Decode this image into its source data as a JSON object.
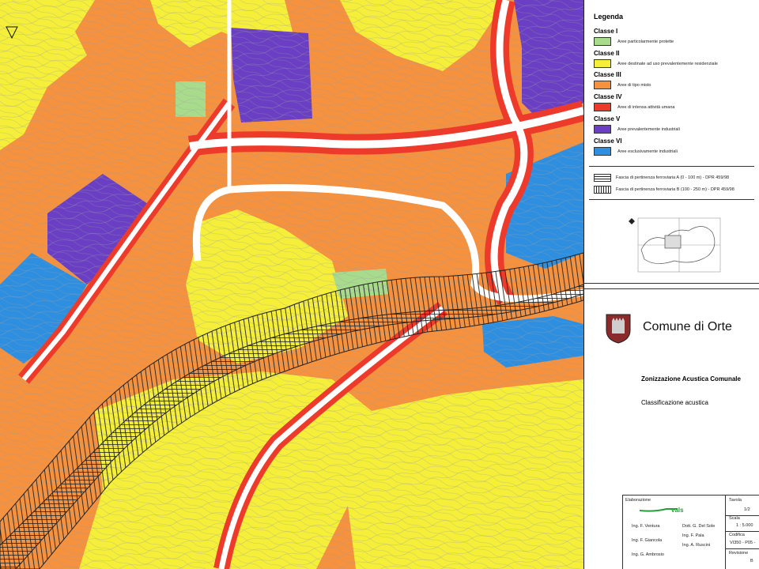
{
  "legend": {
    "title": "Legenda",
    "classes": [
      {
        "name": "Classe I",
        "desc": "Aree particolarmente protette",
        "color": "#a8dc8c"
      },
      {
        "name": "Classe II",
        "desc": "Aree destinate ad uso prevalentemente residenziale",
        "color": "#f5ef3a"
      },
      {
        "name": "Classe III",
        "desc": "Aree di tipo misto",
        "color": "#f6913e"
      },
      {
        "name": "Classe IV",
        "desc": "Aree di intensa attività umana",
        "color": "#ee3a2a"
      },
      {
        "name": "Classe V",
        "desc": "Aree prevalentemente industriali",
        "color": "#6a3fc4"
      },
      {
        "name": "Classe VI",
        "desc": "Aree esclusivamente industriali",
        "color": "#2e8fe0"
      }
    ],
    "rail_bands": [
      {
        "desc": "Fascia di pertinenza ferroviaria A (0 - 100 m) - DPR 459/98",
        "pattern": "horizontal"
      },
      {
        "desc": "Fascia di pertinenza ferroviaria B (100 - 250 m) - DPR 459/98",
        "pattern": "vertical"
      }
    ]
  },
  "title_block": {
    "municipality": "Comune di Orte",
    "project": "Zonizzazione Acustica Comunale",
    "subject": "Classificazione acustica",
    "elaborazione_label": "Elaborazione",
    "people_left": [
      "Ing. F. Ventura",
      "Ing. F. Giancola",
      "Ing. G. Ambrosio"
    ],
    "people_right": [
      "Dott. G. Del Sole",
      "Ing. F. Pala",
      "Ing. A. Ruscini"
    ],
    "tavola_label": "Tavola",
    "tavola_value": "1/2",
    "scala_label": "Scala",
    "scala_value": "1 : 5.000",
    "codifica_label": "Codifica",
    "codifica_value": "VI350 - P05 -",
    "revisione_label": "Revisione",
    "revisione_value": "B"
  },
  "colors": {
    "class_i": "#a8dc8c",
    "class_ii": "#f5ef3a",
    "class_iii": "#f6913e",
    "class_iv": "#ee3a2a",
    "class_v": "#6a3fc4",
    "class_vi": "#2e8fe0",
    "road": "#ffffff",
    "contour": "#9a9a9a"
  }
}
